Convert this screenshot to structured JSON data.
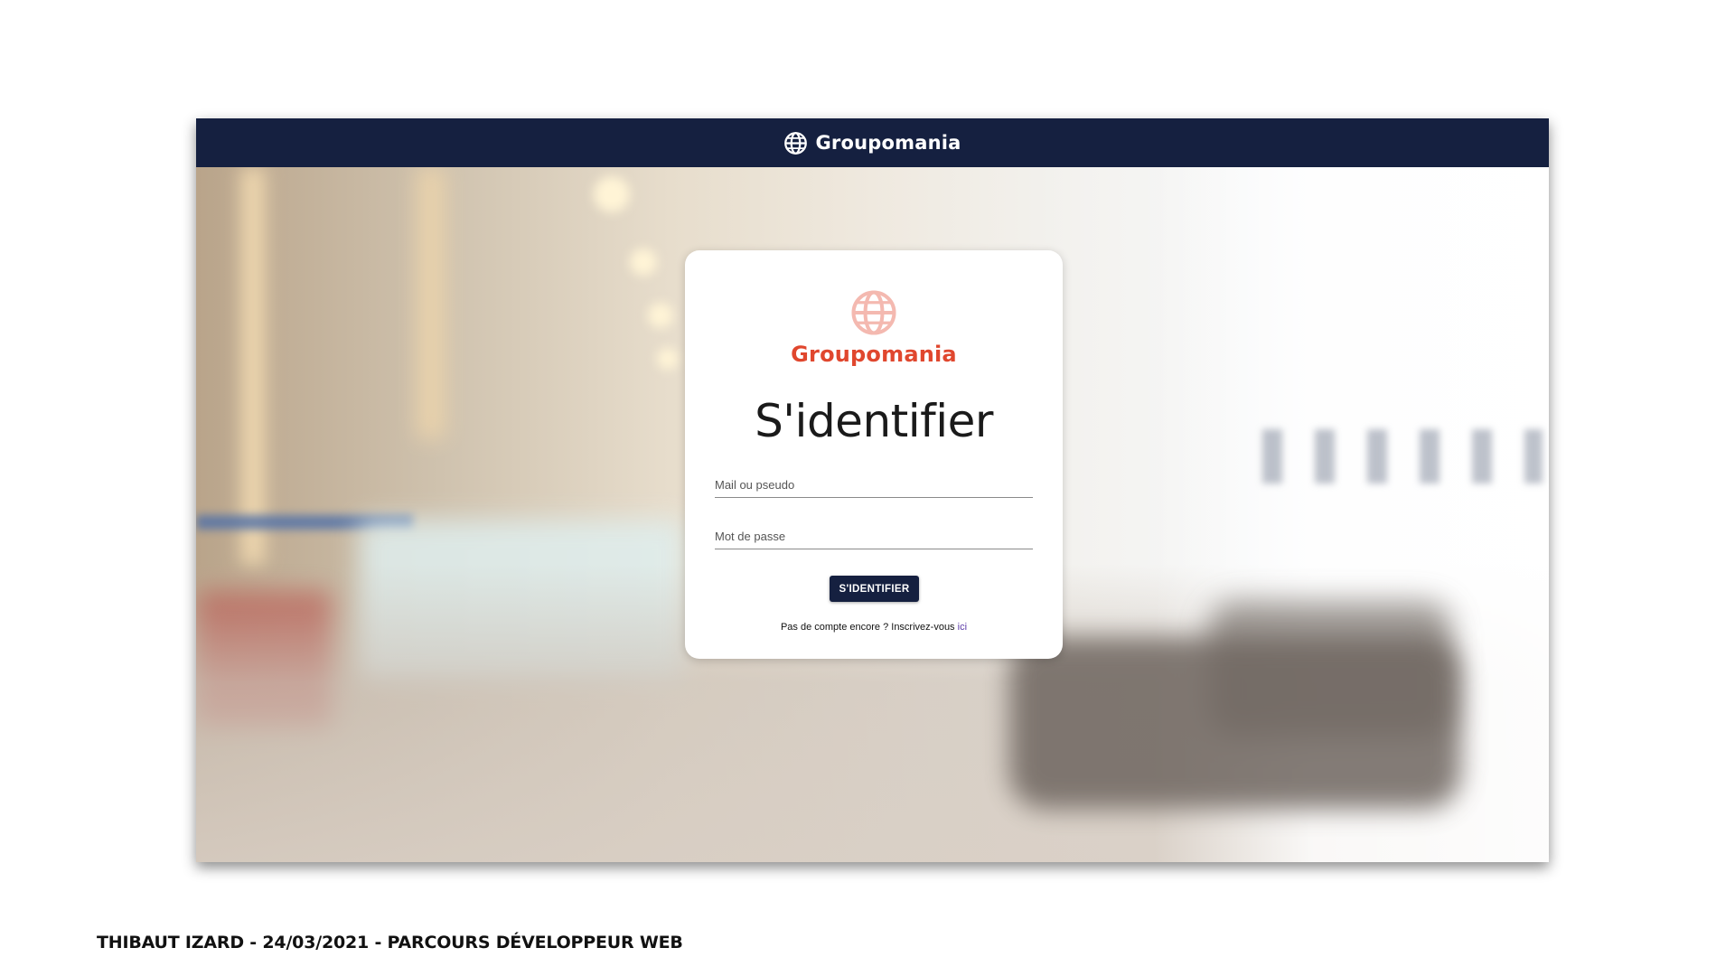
{
  "header": {
    "brand": "Groupomania",
    "logo_icon": "globe-icon",
    "background_color": "#152040"
  },
  "card": {
    "logo_icon": "globe-icon",
    "logo_text": "Groupomania",
    "logo_color": "#e0472e",
    "title": "S'identifier",
    "login_field": {
      "placeholder": "Mail ou pseudo",
      "value": ""
    },
    "password_field": {
      "placeholder": "Mot de passe",
      "value": ""
    },
    "submit_label": "S'IDENTIFIER",
    "signup_text": "Pas de compte encore ? Inscrivez-vous",
    "signup_link": "ici"
  },
  "footer": {
    "caption": "THIBAUT IZARD - 24/03/2021 - PARCOURS DÉVELOPPEUR WEB"
  }
}
